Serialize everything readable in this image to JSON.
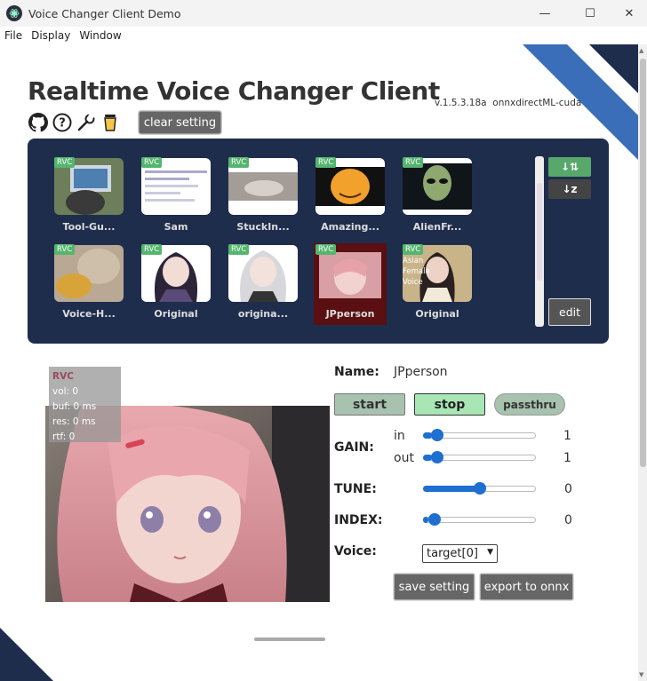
{
  "window": {
    "title": "Voice Changer Client Demo",
    "minimize": "—",
    "maximize": "☐",
    "close": "✕"
  },
  "menu": [
    "File",
    "Display",
    "Window"
  ],
  "header": {
    "title": "Realtime Voice Changer Client",
    "version": "v.1.5.3.18a",
    "backend": "onnxdirectML-cuda",
    "clear_label": "clear setting",
    "icons": [
      "github-icon",
      "help-icon",
      "wrench-icon",
      "coffee-icon"
    ]
  },
  "models": [
    {
      "badge": "RVC",
      "label": "Tool-Gu..."
    },
    {
      "badge": "RVC",
      "label": "Sam"
    },
    {
      "badge": "RVC",
      "label": "StuckIn..."
    },
    {
      "badge": "RVC",
      "label": "Amazing..."
    },
    {
      "badge": "RVC",
      "label": "AlienFr..."
    },
    {
      "badge": "RVC",
      "label": "Voice-H..."
    },
    {
      "badge": "RVC",
      "label": "Original"
    },
    {
      "badge": "RVC",
      "label": "origina..."
    },
    {
      "badge": "RVC",
      "label": "JPperson",
      "selected": true
    },
    {
      "badge": "RVC",
      "label": "Original",
      "overlay": "Asian Female Voice"
    }
  ],
  "panel": {
    "sort1": "↓⇅",
    "sort2": "↓z",
    "edit_label": "edit"
  },
  "stats": {
    "type": "RVC",
    "vol": "vol: 0",
    "buf": "buf: 0 ms",
    "res": "res: 0 ms",
    "rtf": "rtf: 0"
  },
  "controls": {
    "name_label": "Name:",
    "name_value": "JPperson",
    "start_label": "start",
    "stop_label": "stop",
    "passthru_label": "passthru",
    "gain_label": "GAIN:",
    "gain_in_label": "in",
    "gain_out_label": "out",
    "gain_in_value": "1",
    "gain_out_value": "1",
    "gain_in_level": 0.08,
    "gain_out_level": 0.08,
    "tune_label": "TUNE:",
    "tune_value": "0",
    "tune_level": 0.5,
    "index_label": "INDEX:",
    "index_value": "0",
    "index_level": 0.05,
    "voice_label": "Voice:",
    "voice_value": "target[0]",
    "save_label": "save setting",
    "export_label": "export to onnx"
  },
  "colors": {
    "panel": "#1f2d4d",
    "accent": "#1e6fd0",
    "badge": "#55b56e",
    "deco": "#3a6eb8"
  }
}
